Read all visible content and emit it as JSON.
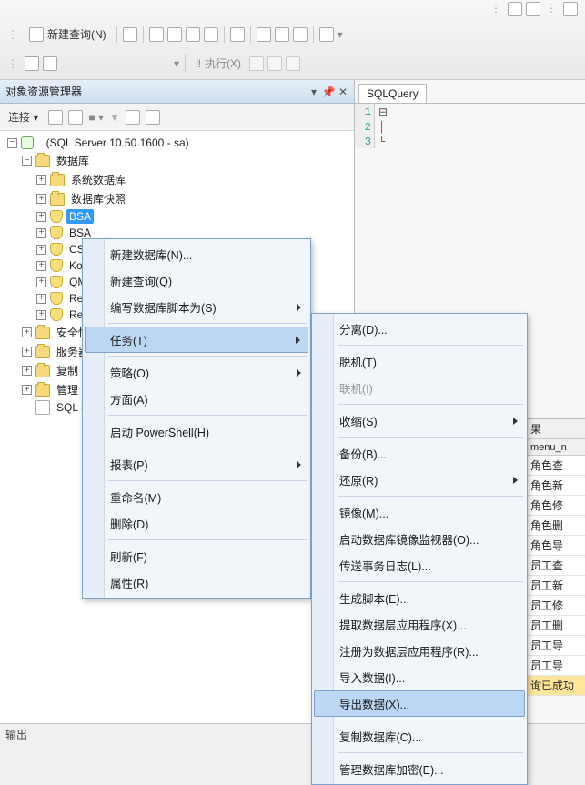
{
  "toolbar": {
    "new_query": "新建查询(N)",
    "execute": "执行(X)"
  },
  "object_explorer": {
    "title": "对象资源管理器",
    "connect_label": "连接 ▾",
    "root": ". (SQL Server 10.50.1600 - sa)",
    "databases": "数据库",
    "sys_db": "系统数据库",
    "snapshot": "数据库快照",
    "db_items": [
      "BSA",
      "BSA",
      "CSA",
      "Kop",
      "QMI",
      "Rep",
      "Rep"
    ],
    "security": "安全性",
    "server_obj": "服务器对",
    "replication": "复制",
    "management": "管理",
    "sql_agent": "SQL Se"
  },
  "context_menu_1": {
    "new_db": "新建数据库(N)...",
    "new_query": "新建查询(Q)",
    "script_db": "编写数据库脚本为(S)",
    "tasks": "任务(T)",
    "policies": "策略(O)",
    "facets": "方面(A)",
    "powershell": "启动 PowerShell(H)",
    "reports": "报表(P)",
    "rename": "重命名(M)",
    "delete": "删除(D)",
    "refresh": "刷新(F)",
    "properties": "属性(R)"
  },
  "context_menu_2": {
    "detach": "分离(D)...",
    "offline": "脱机(T)",
    "online": "联机(I)",
    "shrink": "收缩(S)",
    "backup": "备份(B)...",
    "restore": "还原(R)",
    "mirror": "镜像(M)...",
    "launch_mirror": "启动数据库镜像监视器(O)...",
    "ship_log": "传送事务日志(L)...",
    "gen_script": "生成脚本(E)...",
    "extract_app": "提取数据层应用程序(X)...",
    "register_app": "注册为数据层应用程序(R)...",
    "import": "导入数据(I)...",
    "export": "导出数据(X)...",
    "copy_db": "复制数据库(C)...",
    "manage_enc": "管理数据库加密(E)..."
  },
  "editor": {
    "tab": "SQLQuery",
    "lines": [
      "1",
      "2",
      "3"
    ]
  },
  "results": {
    "tab": "果",
    "header": "menu_n",
    "rows": [
      "角色查",
      "角色新",
      "角色修",
      "角色删",
      "角色导",
      "员工查",
      "员工新",
      "员工修",
      "员工删",
      "员工导",
      "员工导"
    ],
    "highlight": "询已成功"
  },
  "status": {
    "text": "输出"
  }
}
